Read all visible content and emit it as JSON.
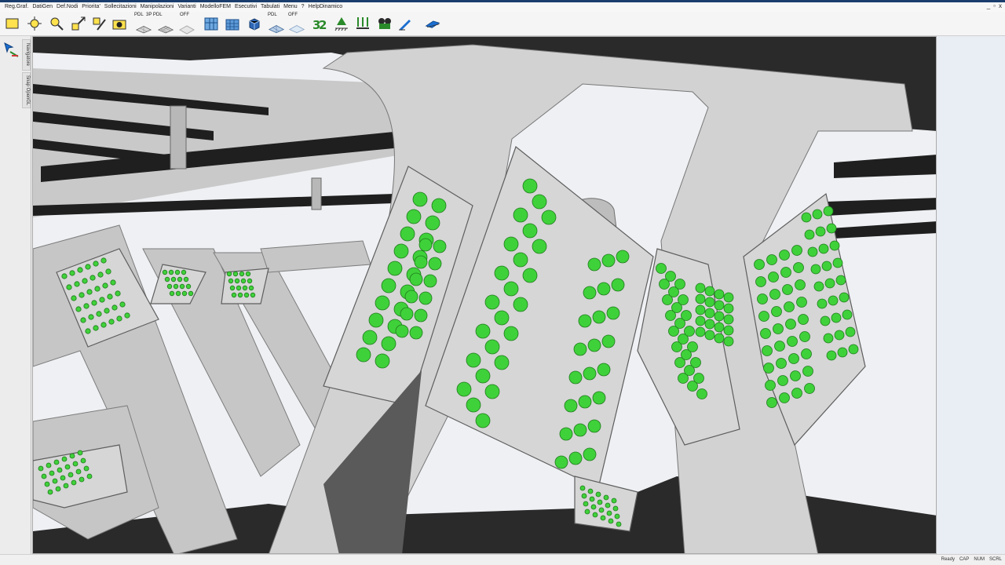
{
  "menu": {
    "items": [
      "Reg.Graf.",
      "DatiGen",
      "Def.Nodi",
      "Priorita'",
      "Sollecitazioni",
      "Manipolazioni",
      "Varianti",
      "ModelloFEM",
      "Esecutivi",
      "Tabulati",
      "Menu",
      "?",
      "HelpDinamico"
    ]
  },
  "window_controls": [
    "_",
    "▫",
    "x"
  ],
  "toolbar": {
    "labels": {
      "pdl": "PDL",
      "p3d": "3P PDL",
      "off1": "OFF",
      "pdl2": "PDL",
      "off2": "OFF"
    }
  },
  "left_panel": {
    "tabs": [
      "Navigatore",
      "Snap OpenGL"
    ]
  },
  "status": {
    "ready": "Ready",
    "indicators": [
      "CAP",
      "NUM",
      "SCRL"
    ]
  },
  "colors": {
    "steel": "#cfcfcf",
    "steel_dark": "#9a9a9a",
    "bolt": "#3fd13a",
    "bolt_edge": "#1f7a1c",
    "shadow": "#1e1e1e",
    "accent": "#1a3d6e"
  }
}
